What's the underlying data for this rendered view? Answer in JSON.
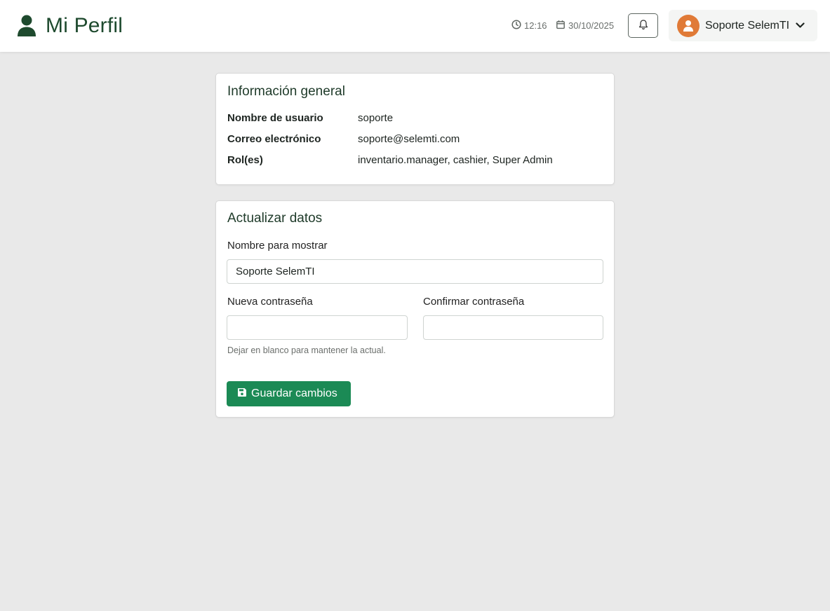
{
  "header": {
    "title": "Mi Perfil",
    "time": "12:16",
    "date": "30/10/2025",
    "user_name": "Soporte SelemTI"
  },
  "info_card": {
    "title": "Información general",
    "rows": [
      {
        "label": "Nombre de usuario",
        "value": "soporte"
      },
      {
        "label": "Correo electrónico",
        "value": "soporte@selemti.com"
      },
      {
        "label": "Rol(es)",
        "value": "inventario.manager, cashier, Super Admin"
      }
    ]
  },
  "update_card": {
    "title": "Actualizar datos",
    "display_name_label": "Nombre para mostrar",
    "display_name_value": "Soporte SelemTI",
    "new_password_label": "Nueva contraseña",
    "confirm_password_label": "Confirmar contraseña",
    "new_password_value": "",
    "confirm_password_value": "",
    "hint": "Dejar en blanco para mantener la actual.",
    "save_label": "Guardar cambios"
  },
  "icons": {
    "title": "user-icon",
    "time": "clock-icon",
    "date": "calendar-icon",
    "notifications": "bell-icon",
    "avatar": "avatar-person-icon",
    "menu": "chevron-down-icon",
    "save": "floppy-disk-icon"
  },
  "colors": {
    "brand_dark_green": "#1e4a2e",
    "primary_button": "#1b8a55",
    "avatar_orange": "#e07a37",
    "background": "#e9e9e9"
  }
}
